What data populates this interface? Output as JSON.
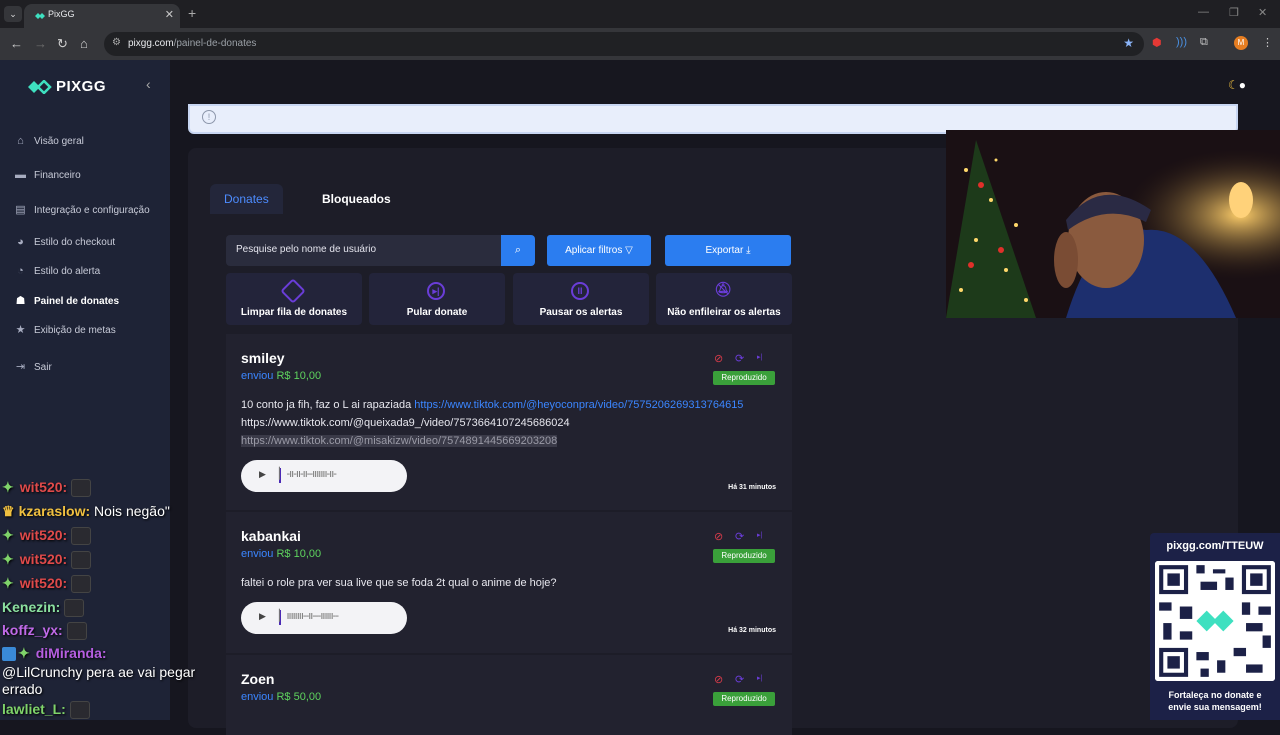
{
  "browser": {
    "tab_title": "PixGG",
    "url_host": "pixgg.com",
    "url_path": "/painel-de-donates",
    "profile_initial": "M"
  },
  "sidebar": {
    "logo": "PIXGG",
    "items": [
      {
        "label": "Visão geral",
        "icon": "home-icon"
      },
      {
        "label": "Financeiro",
        "icon": "wallet-icon"
      },
      {
        "label": "Integração e configuração",
        "icon": "settings-icon"
      },
      {
        "label": "Estilo do checkout",
        "icon": "palette-icon"
      },
      {
        "label": "Estilo do alerta",
        "icon": "palette-icon"
      },
      {
        "label": "Painel de donates",
        "icon": "users-icon"
      },
      {
        "label": "Exibição de metas",
        "icon": "star-icon"
      },
      {
        "label": "Sair",
        "icon": "logout-icon"
      }
    ],
    "active_index": 5
  },
  "main": {
    "tabs": [
      "Donates",
      "Bloqueados"
    ],
    "search_placeholder": "Pesquise pelo nome de usuário",
    "filter_label": "Aplicar filtros",
    "export_label": "Exportar",
    "actions": [
      {
        "label": "Limpar fila de donates",
        "icon": "eraser-icon"
      },
      {
        "label": "Pular donate",
        "icon": "skip-icon"
      },
      {
        "label": "Pausar os alertas",
        "icon": "pause-icon"
      },
      {
        "label": "Não enfileirar os alertas",
        "icon": "bell-off-icon"
      }
    ],
    "donations": [
      {
        "name": "smiley",
        "sent_prefix": "enviou",
        "amount": "R$ 10,00",
        "status": "Reproduzido",
        "msg_text": "10 conto ja fih, faz o L ai rapaziada ",
        "msg_link": "https://www.tiktok.com/@heyoconpra/video/7575206269313764615",
        "msg_line2": "https://www.tiktok.com/@queixada9_/video/7573664107245686024",
        "msg_line3": "https://www.tiktok.com/@misakizw/video/7574891445669203208",
        "time": "Há 31 minutos"
      },
      {
        "name": "kabankai",
        "sent_prefix": "enviou",
        "amount": "R$ 10,00",
        "status": "Reproduzido",
        "msg_text": "faltei o role pra ver sua live que se foda 2t qual o anime de hoje?",
        "time": "Há 32 minutos"
      },
      {
        "name": "Zoen",
        "sent_prefix": "enviou",
        "amount": "R$ 50,00",
        "status": "Reproduzido"
      }
    ]
  },
  "chat": [
    {
      "user": "wit520:",
      "color": "#e04a4a",
      "badge": "✦",
      "text": ""
    },
    {
      "user": "kzaraslow:",
      "color": "#f0c040",
      "badge": "♛",
      "text": "Nois negão\""
    },
    {
      "user": "wit520:",
      "color": "#e04a4a",
      "badge": "✦",
      "text": ""
    },
    {
      "user": "wit520:",
      "color": "#e04a4a",
      "badge": "✦",
      "text": ""
    },
    {
      "user": "wit520:",
      "color": "#e04a4a",
      "badge": "✦",
      "text": ""
    },
    {
      "user": "Kenezin:",
      "color": "#8be0a0",
      "badge": "",
      "text": ""
    },
    {
      "user": "koffz_yx:",
      "color": "#c06ae8",
      "badge": "",
      "text": ""
    },
    {
      "user": "diMiranda:",
      "color": "#b65ee0",
      "badge": "✦",
      "text": ""
    },
    {
      "user": "",
      "color": "#fff",
      "badge": "",
      "text": "@LilCrunchy pera ae vai pegar"
    },
    {
      "user": "",
      "color": "#fff",
      "badge": "",
      "text": "errado"
    },
    {
      "user": "lawliet_L:",
      "color": "#7fd36a",
      "badge": "",
      "text": ""
    }
  ],
  "qr": {
    "url": "pixgg.com/TTEUW",
    "caption_line1": "Fortaleça no donate e",
    "caption_line2": "envie sua mensagem!"
  }
}
